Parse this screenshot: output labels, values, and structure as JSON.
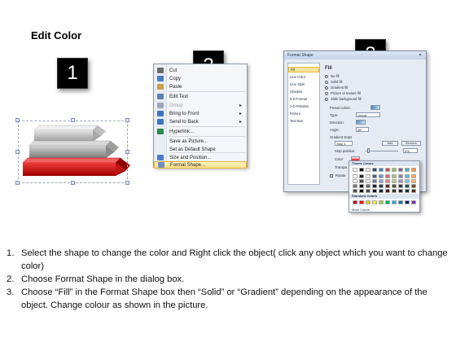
{
  "title": "Edit Color",
  "steps": [
    "1",
    "2",
    "3"
  ],
  "context_menu": {
    "items": [
      {
        "label": "Cut",
        "icon": "scissors-icon",
        "color": "#6b6b6b"
      },
      {
        "label": "Copy",
        "icon": "copy-icon",
        "color": "#4a7cc4"
      },
      {
        "label": "Paste",
        "icon": "paste-icon",
        "color": "#c9a24a"
      },
      {
        "label": "Edit Text",
        "icon": "edit-text-icon",
        "color": "#5b7fb5"
      },
      {
        "label": "Group",
        "icon": "group-icon",
        "color": "#9aa7bb",
        "disabled": true,
        "submenu": true
      },
      {
        "label": "Bring to Front",
        "icon": "bring-to-front-icon",
        "color": "#3b73c2",
        "submenu": true
      },
      {
        "label": "Send to Back",
        "icon": "send-to-back-icon",
        "color": "#3b73c2",
        "submenu": true
      },
      {
        "label": "Hyperlink...",
        "icon": "globe-icon",
        "color": "#2a8a4a"
      },
      {
        "label": "Save as Picture...",
        "icon": "",
        "color": ""
      },
      {
        "label": "Set as Default Shape",
        "icon": "",
        "color": ""
      },
      {
        "label": "Size and Position...",
        "icon": "size-position-icon",
        "color": "#4a7cc4"
      },
      {
        "label": "Format Shape...",
        "icon": "format-shape-icon",
        "color": "#6f8fc0",
        "highlighted": true
      }
    ]
  },
  "dialog": {
    "title": "Format Shape",
    "nav": [
      "Fill",
      "Line Color",
      "Line Style",
      "Shadow",
      "3-D Format",
      "3-D Rotation",
      "Picture",
      "Text Box"
    ],
    "fill_heading": "Fill",
    "fill_options": [
      "No fill",
      "Solid fill",
      "Gradient fill",
      "Picture or texture fill",
      "Slide background fill"
    ],
    "selected_option": "Gradient fill",
    "preset_colors_label": "Preset colors:",
    "type_label": "Type:",
    "type_value": "Linear",
    "direction_label": "Direction:",
    "angle_label": "Angle:",
    "angle_value": "45°",
    "gradient_stops_label": "Gradient stops",
    "stop_value": "Stop 1",
    "add_label": "Add",
    "remove_label": "Remove",
    "stop_position_label": "Stop position:",
    "stop_position_value": "0%",
    "color_label": "Color:",
    "transparency_label": "Transpa",
    "rotate_label": "Rotate"
  },
  "palette": {
    "theme_label": "Theme Colors",
    "standard_label": "Standard Colors",
    "more_label": "More Colors...",
    "theme_top": [
      "#ffffff",
      "#000000",
      "#eeece1",
      "#1f497d",
      "#4f81bd",
      "#c0504d",
      "#9bbb59",
      "#8064a2",
      "#4bacc6",
      "#f79646"
    ],
    "standard": [
      "#c00000",
      "#ff0000",
      "#ffc000",
      "#ffff00",
      "#92d050",
      "#00b050",
      "#00b0f0",
      "#0070c0",
      "#002060",
      "#7030a0"
    ]
  },
  "instructions": [
    {
      "num": "1.",
      "text": "Select the shape to change the color and Right click the object( click any object which you want to change color)"
    },
    {
      "num": "2.",
      "text": "Choose Format Shape in the dialog box."
    },
    {
      "num": "3.",
      "text": "Choose “Fill” in the Format Shape box then “Solid” or “Gradient” depending on the appearance of the object. Change colour as shown in the picture."
    }
  ]
}
